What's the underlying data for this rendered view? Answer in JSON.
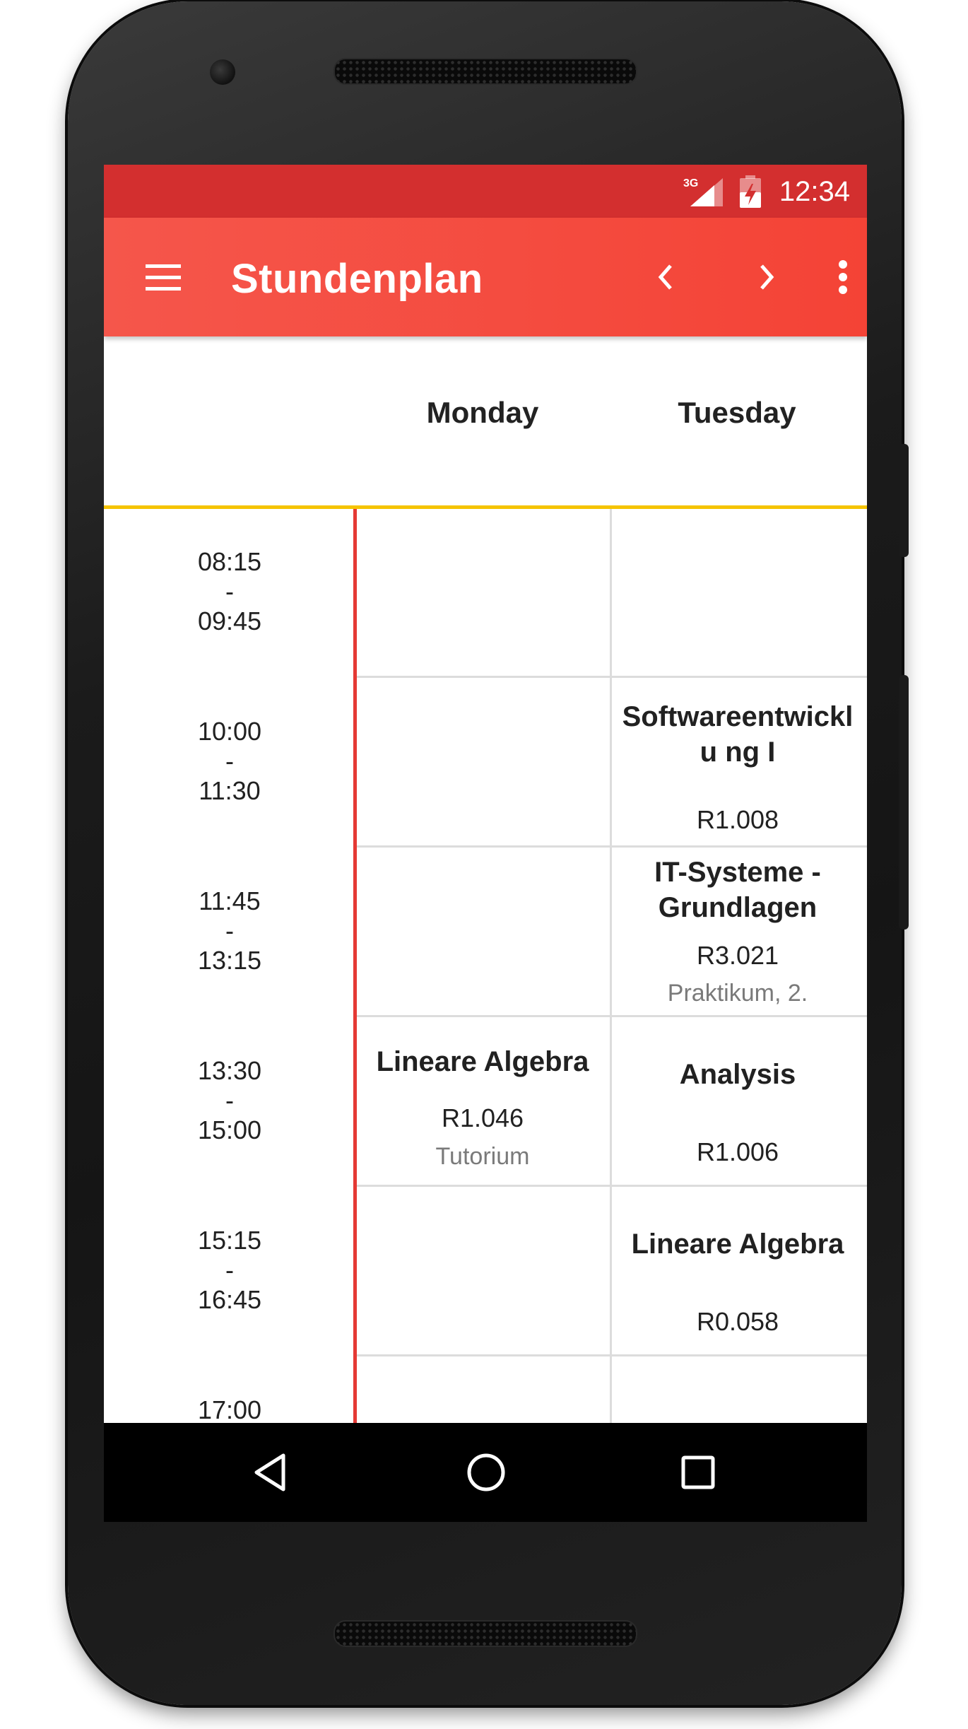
{
  "status_bar": {
    "network": "3G",
    "time": "12:34",
    "color": "#d32f2f"
  },
  "toolbar": {
    "title": "Stundenplan",
    "color": "#f44336",
    "icons": [
      "menu-icon",
      "chevron-left-icon",
      "chevron-right-icon",
      "more-vert-icon"
    ]
  },
  "header": {
    "days": [
      "Monday",
      "Tuesday"
    ],
    "accent_color": "#f5c400"
  },
  "timeslots": [
    {
      "start": "08:15",
      "sep": "-",
      "end": "09:45"
    },
    {
      "start": "10:00",
      "sep": "-",
      "end": "11:30"
    },
    {
      "start": "11:45",
      "sep": "-",
      "end": "13:15"
    },
    {
      "start": "13:30",
      "sep": "-",
      "end": "15:00"
    },
    {
      "start": "15:15",
      "sep": "-",
      "end": "16:45"
    },
    {
      "start": "17:00",
      "sep": "",
      "end": ""
    }
  ],
  "courses": {
    "mon_1330": {
      "name": "Lineare Algebra",
      "room": "R1.046",
      "type": "Tutorium"
    },
    "tue_1000": {
      "name": "Softwareentwicklu ng I",
      "room": "R1.008"
    },
    "tue_1145": {
      "name": "IT-Systeme - Grundlagen",
      "room": "R3.021",
      "type": "Praktikum, 2."
    },
    "tue_1330": {
      "name": "Analysis",
      "room": "R1.006"
    },
    "tue_1515": {
      "name": "Lineare Algebra",
      "room": "R0.058"
    }
  },
  "now_indicator_color": "#e53935",
  "nav_bar": {
    "icons": [
      "back-icon",
      "home-icon",
      "recents-icon"
    ]
  }
}
